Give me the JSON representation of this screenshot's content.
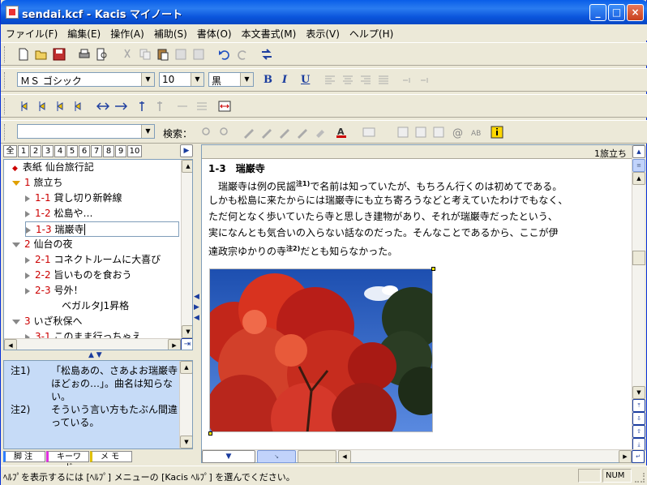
{
  "window": {
    "title": "sendai.kcf - Kacis マイノート",
    "min": "_",
    "max": "□",
    "close": "×"
  },
  "menu": [
    "ファイル(F)",
    "編集(E)",
    "操作(A)",
    "補助(S)",
    "書体(O)",
    "本文書式(M)",
    "表示(V)",
    "ヘルプ(H)"
  ],
  "format": {
    "font": "ＭＳ ゴシック",
    "size": "10",
    "color": "黒",
    "bold": "B",
    "italic": "I",
    "underline": "U"
  },
  "search": {
    "label": "検索：",
    "value": ""
  },
  "tabs": [
    "全",
    "1",
    "2",
    "3",
    "4",
    "5",
    "6",
    "7",
    "8",
    "9",
    "10"
  ],
  "tree": [
    {
      "num": "",
      "label": "表紙 仙台旅行記",
      "level": 0,
      "marker": "diamond"
    },
    {
      "num": "1",
      "label": "旅立ち",
      "level": 0,
      "marker": "open"
    },
    {
      "num": "1-1",
      "label": "貸し切り新幹線",
      "level": 1,
      "marker": "leaf"
    },
    {
      "num": "1-2",
      "label": "松島や…",
      "level": 1,
      "marker": "leaf"
    },
    {
      "num": "1-3",
      "label": "瑞巌寺",
      "level": 1,
      "marker": "leaf",
      "selected": true
    },
    {
      "num": "2",
      "label": "仙台の夜",
      "level": 0,
      "marker": "open-gray"
    },
    {
      "num": "2-1",
      "label": "コネクトルームに大喜び",
      "level": 1,
      "marker": "leaf"
    },
    {
      "num": "2-2",
      "label": "旨いものを食おう",
      "level": 1,
      "marker": "leaf"
    },
    {
      "num": "2-3",
      "label": "号外！",
      "level": 1,
      "marker": "leaf"
    },
    {
      "num": "",
      "label": "ベガルタJ1昇格",
      "level": 2,
      "marker": "none"
    },
    {
      "num": "3",
      "label": "いざ秋保へ",
      "level": 0,
      "marker": "open-gray"
    },
    {
      "num": "3-1",
      "label": "このまま行っちゃえ",
      "level": 1,
      "marker": "leaf"
    }
  ],
  "notes": [
    {
      "key": "注1)",
      "lines": [
        "「松島あの、さあよお瑞巌寺",
        "ほどぉの…」。曲名は知らな",
        "い。"
      ]
    },
    {
      "key": "注2)",
      "lines": [
        "そういう言い方もたぶん間違",
        "っている。"
      ]
    }
  ],
  "bottom_tabs": [
    "脚 注",
    "キーワード",
    "メ モ"
  ],
  "doc": {
    "section_tag": "1旅立ち",
    "heading_num": "1-3",
    "heading": "瑞巌寺",
    "lines": [
      {
        "t": "　瑞巌寺は例の民謡",
        "sup": "注1)",
        "t2": "で名前は知っていたが、もちろん行くのは初めてである。"
      },
      {
        "t": "しかも松島に来たからには瑞巌寺にも立ち寄ろうなどと考えていたわけでもなく、"
      },
      {
        "t": "ただ何となく歩いていたら寺と思しき建物があり、それが瑞巌寺だったという、"
      },
      {
        "t": "実になんとも気合いの入らない話なのだった。そんなことであるから、ここが伊"
      },
      {
        "t": "達政宗ゆかりの寺",
        "sup": "注2)",
        "t2": "だとも知らなかった。"
      }
    ]
  },
  "status": {
    "message": "ﾍﾙﾌﾟを表示するには [ﾍﾙﾌﾟ] メニューの [Kacis ﾍﾙﾌﾟ] を選んでください。",
    "num": "NUM"
  }
}
